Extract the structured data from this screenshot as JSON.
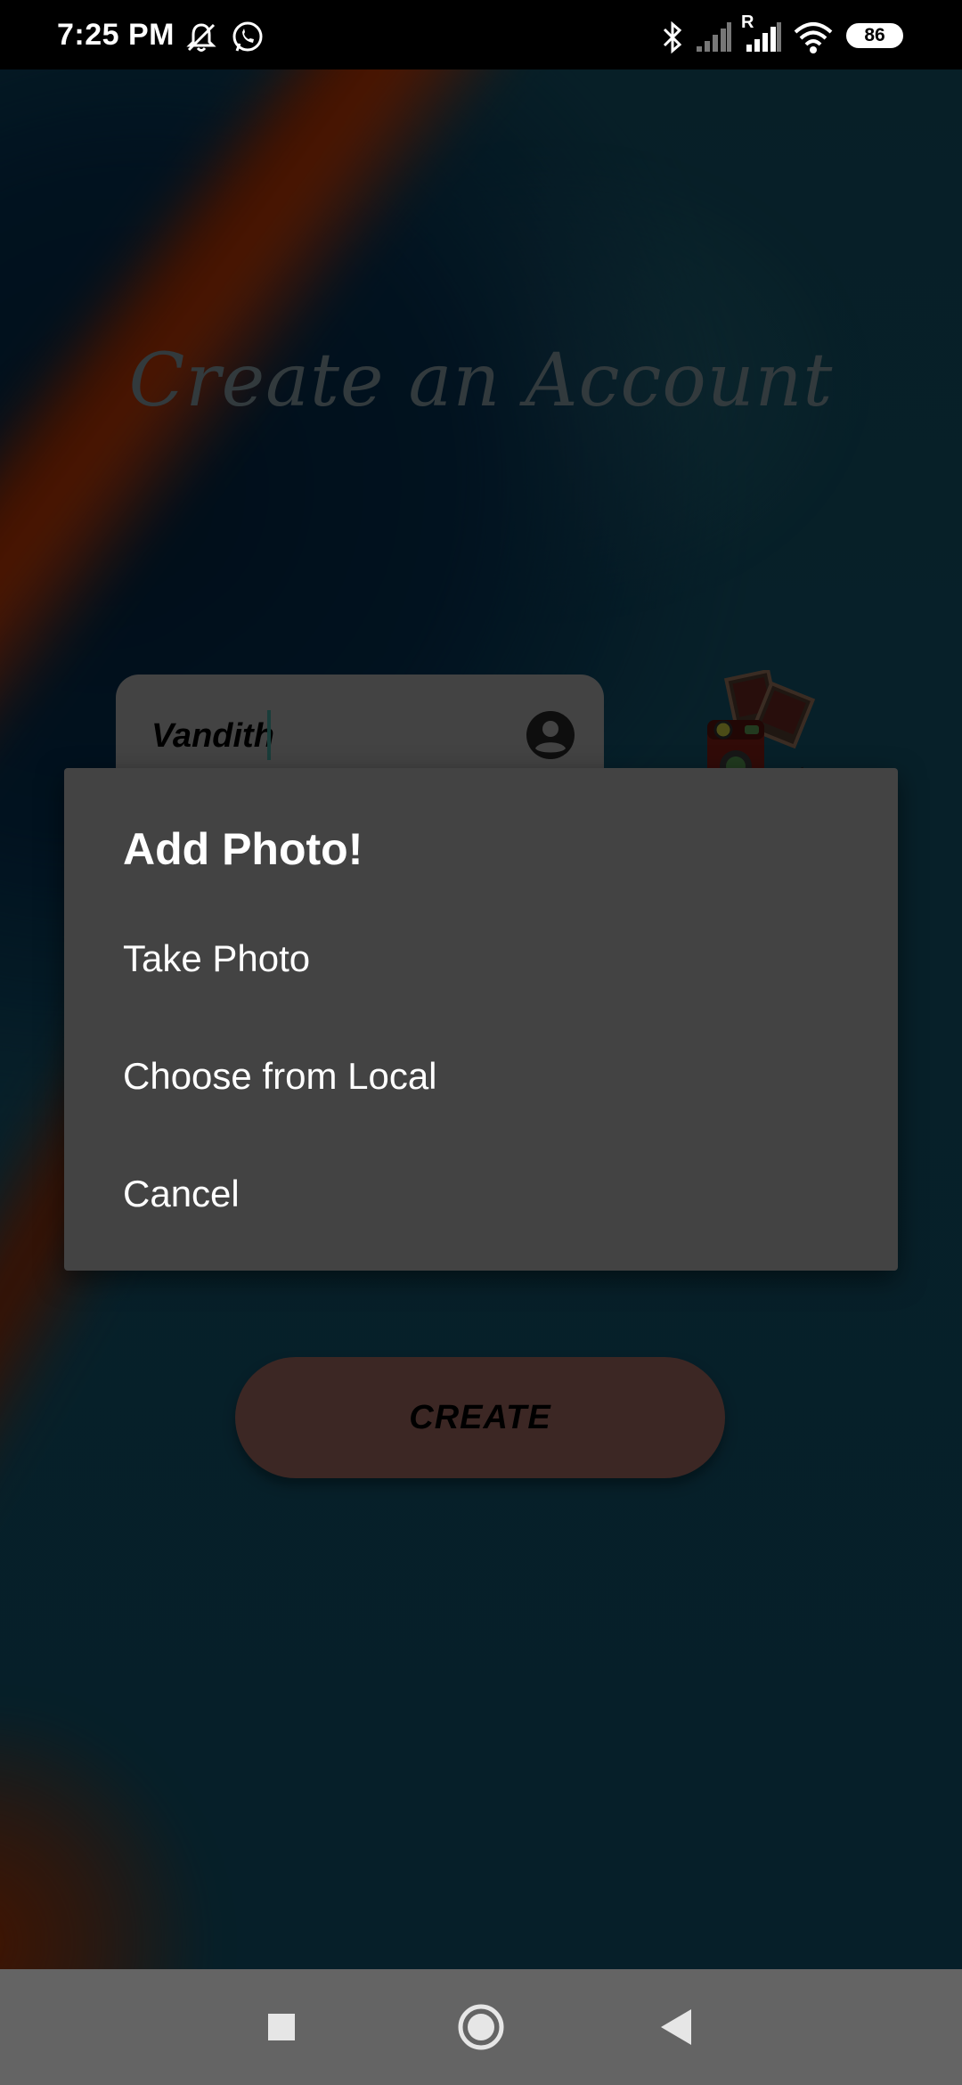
{
  "status_bar": {
    "time": "7:25 PM",
    "battery": "86",
    "icons": [
      "mute-icon",
      "whatsapp-icon",
      "bluetooth-icon",
      "signal-icon",
      "roaming-signal-icon",
      "wifi-icon",
      "battery-icon"
    ],
    "roaming_label": "R"
  },
  "page": {
    "title": "Create an Account",
    "name_field": {
      "value": "Vandith",
      "icon": "account-circle-icon"
    },
    "photo_picture": "camera-with-photos",
    "create_button": "CREATE"
  },
  "dialog": {
    "title": "Add Photo!",
    "items": [
      "Take Photo",
      "Choose from Local",
      "Cancel"
    ]
  },
  "nav_bar": {
    "buttons": [
      "recents-square-icon",
      "home-circle-icon",
      "back-triangle-icon"
    ]
  },
  "colors": {
    "dialog_bg": "#434343",
    "button_bg": "#6e4842",
    "nav_bg": "#646464",
    "accent_orange": "#8a2a05",
    "background_teal": "#0c3a4a"
  }
}
